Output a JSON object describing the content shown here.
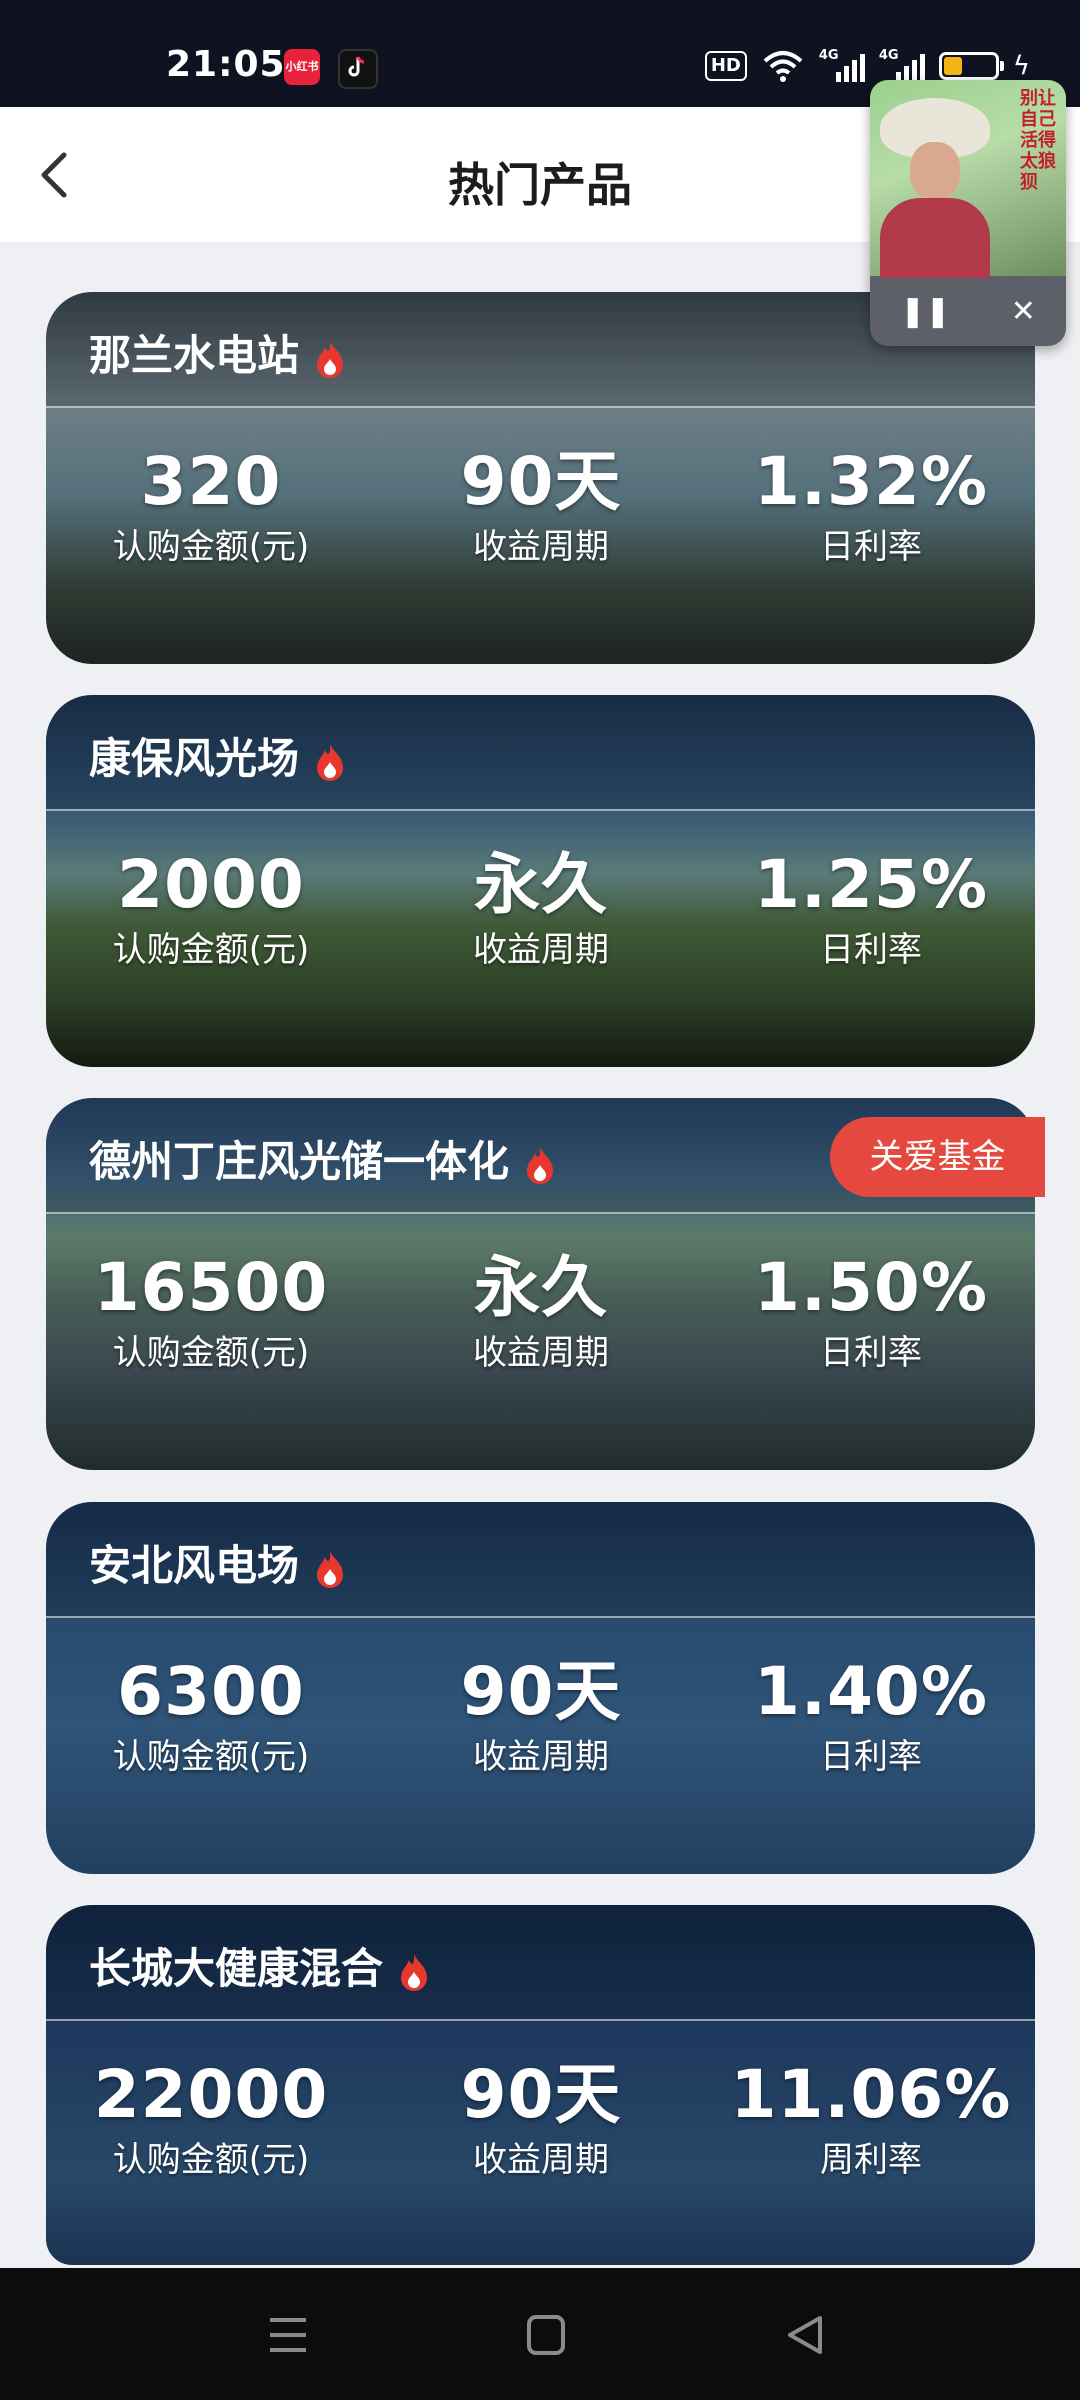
{
  "status_bar": {
    "time": "21:05",
    "app_icons": [
      "xiaohongshu-icon",
      "tiktok-icon"
    ],
    "xhs_text": "小红书",
    "hd_label": "HD",
    "signal_label_1": "4G",
    "signal_label_2": "4G",
    "battery_level": 0.35,
    "icons": [
      "wifi-icon",
      "signal-icon",
      "battery-icon",
      "charging-icon"
    ]
  },
  "header": {
    "title": "热门产品",
    "back_icon": "chevron-left-icon"
  },
  "floating_video": {
    "overlay_text": "别让自己活得太狼狈",
    "pause_label": "❚❚",
    "close_label": "✕"
  },
  "products": [
    {
      "name": "那兰水电站",
      "amount": "320",
      "amount_label": "认购金额(元)",
      "period": "90天",
      "period_label": "收益周期",
      "rate": "1.32%",
      "rate_label": "日利率"
    },
    {
      "name": "康保风光场",
      "amount": "2000",
      "amount_label": "认购金额(元)",
      "period": "永久",
      "period_label": "收益周期",
      "rate": "1.25%",
      "rate_label": "日利率"
    },
    {
      "name": "德州丁庄风光储一体化",
      "amount": "16500",
      "amount_label": "认购金额(元)",
      "period": "永久",
      "period_label": "收益周期",
      "rate": "1.50%",
      "rate_label": "日利率",
      "badge": "关爱基金"
    },
    {
      "name": "安北风电场",
      "amount": "6300",
      "amount_label": "认购金额(元)",
      "period": "90天",
      "period_label": "收益周期",
      "rate": "1.40%",
      "rate_label": "日利率"
    },
    {
      "name": "长城大健康混合",
      "amount": "22000",
      "amount_label": "认购金额(元)",
      "period": "90天",
      "period_label": "收益周期",
      "rate": "11.06%",
      "rate_label": "周利率"
    }
  ],
  "colors": {
    "badge": "#e5483e",
    "fire": "#e8382e"
  },
  "nav_bar": {
    "icons": [
      "menu-icon",
      "home-square-icon",
      "back-triangle-icon"
    ]
  }
}
